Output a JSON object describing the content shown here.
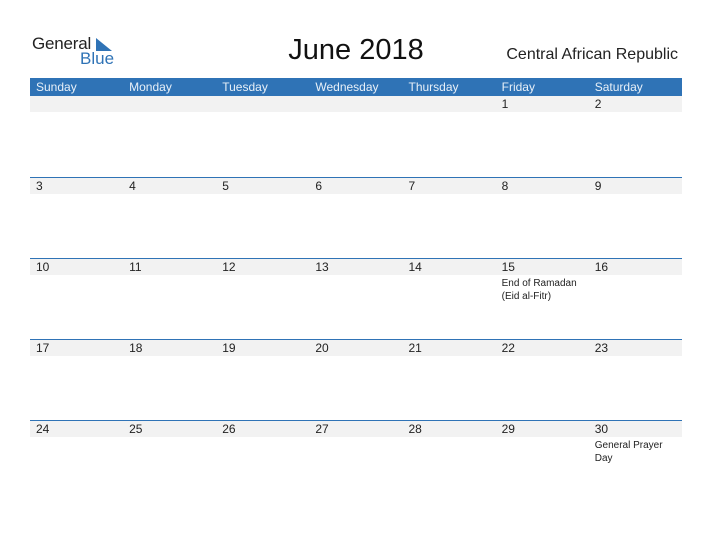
{
  "logo": {
    "word1": "General",
    "word2": "Blue"
  },
  "title": "June 2018",
  "country": "Central African Republic",
  "colors": {
    "accent": "#2f73b6",
    "band": "#f2f2f2"
  },
  "weekdays": [
    "Sunday",
    "Monday",
    "Tuesday",
    "Wednesday",
    "Thursday",
    "Friday",
    "Saturday"
  ],
  "weeks": [
    {
      "days": [
        {
          "num": "",
          "event": ""
        },
        {
          "num": "",
          "event": ""
        },
        {
          "num": "",
          "event": ""
        },
        {
          "num": "",
          "event": ""
        },
        {
          "num": "",
          "event": ""
        },
        {
          "num": "1",
          "event": ""
        },
        {
          "num": "2",
          "event": ""
        }
      ]
    },
    {
      "days": [
        {
          "num": "3",
          "event": ""
        },
        {
          "num": "4",
          "event": ""
        },
        {
          "num": "5",
          "event": ""
        },
        {
          "num": "6",
          "event": ""
        },
        {
          "num": "7",
          "event": ""
        },
        {
          "num": "8",
          "event": ""
        },
        {
          "num": "9",
          "event": ""
        }
      ]
    },
    {
      "days": [
        {
          "num": "10",
          "event": ""
        },
        {
          "num": "11",
          "event": ""
        },
        {
          "num": "12",
          "event": ""
        },
        {
          "num": "13",
          "event": ""
        },
        {
          "num": "14",
          "event": ""
        },
        {
          "num": "15",
          "event": "End of Ramadan (Eid al-Fitr)"
        },
        {
          "num": "16",
          "event": ""
        }
      ]
    },
    {
      "days": [
        {
          "num": "17",
          "event": ""
        },
        {
          "num": "18",
          "event": ""
        },
        {
          "num": "19",
          "event": ""
        },
        {
          "num": "20",
          "event": ""
        },
        {
          "num": "21",
          "event": ""
        },
        {
          "num": "22",
          "event": ""
        },
        {
          "num": "23",
          "event": ""
        }
      ]
    },
    {
      "days": [
        {
          "num": "24",
          "event": ""
        },
        {
          "num": "25",
          "event": ""
        },
        {
          "num": "26",
          "event": ""
        },
        {
          "num": "27",
          "event": ""
        },
        {
          "num": "28",
          "event": ""
        },
        {
          "num": "29",
          "event": ""
        },
        {
          "num": "30",
          "event": "General Prayer Day"
        }
      ]
    }
  ]
}
